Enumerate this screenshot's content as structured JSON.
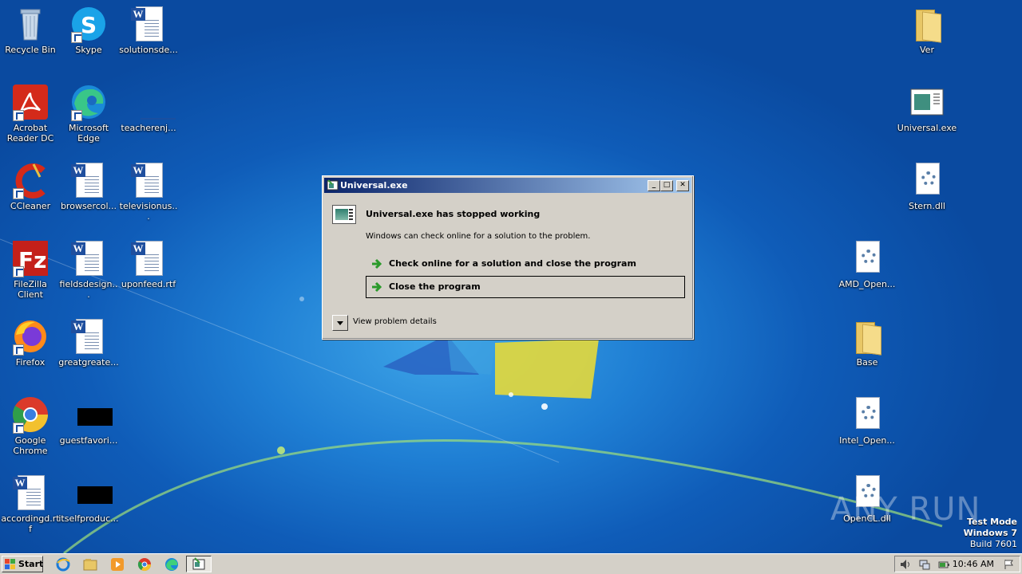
{
  "desktop": {
    "icons_left": [
      {
        "label": "Recycle Bin",
        "icon": "recycle-bin-icon"
      },
      {
        "label": "Skype",
        "icon": "skype-icon"
      },
      {
        "label": "solutionsde...",
        "icon": "word-document-icon"
      },
      {
        "label": "Acrobat Reader DC",
        "icon": "acrobat-icon"
      },
      {
        "label": "Microsoft Edge",
        "icon": "edge-icon"
      },
      {
        "label": "teacherenj...",
        "icon": "blank-file-icon"
      },
      {
        "label": "CCleaner",
        "icon": "ccleaner-icon"
      },
      {
        "label": "browsercol...",
        "icon": "word-document-icon"
      },
      {
        "label": "televisionus...",
        "icon": "word-document-icon"
      },
      {
        "label": "FileZilla Client",
        "icon": "filezilla-icon"
      },
      {
        "label": "fieldsdesign...",
        "icon": "word-document-icon"
      },
      {
        "label": "uponfeed.rtf",
        "icon": "word-document-icon"
      },
      {
        "label": "Firefox",
        "icon": "firefox-icon"
      },
      {
        "label": "greatgreate...",
        "icon": "word-document-icon"
      },
      {
        "label": "Google Chrome",
        "icon": "chrome-icon"
      },
      {
        "label": "guestfavori...",
        "icon": "black-file-icon"
      },
      {
        "label": "accordingd.rtf",
        "icon": "word-document-icon"
      },
      {
        "label": "itselfproduc...",
        "icon": "black-file-icon"
      }
    ],
    "icons_right": [
      {
        "label": "Ver",
        "icon": "folder-icon"
      },
      {
        "label": "Universal.exe",
        "icon": "app-window-icon"
      },
      {
        "label": "Stern.dll",
        "icon": "dll-gear-icon"
      },
      {
        "label": "AMD_Open...",
        "icon": "dll-gear-icon"
      },
      {
        "label": "Base",
        "icon": "folder-icon"
      },
      {
        "label": "Intel_Open...",
        "icon": "dll-gear-icon"
      },
      {
        "label": "OpenCL.dll",
        "icon": "dll-gear-icon"
      }
    ]
  },
  "dialog": {
    "title": "Universal.exe",
    "heading": "Universal.exe has stopped working",
    "message": "Windows can check online for a solution to the problem.",
    "option_check": "Check online for a solution and close the program",
    "option_close": "Close the program",
    "details_label": "View problem details",
    "btn_minimize": "_",
    "btn_maximize": "□",
    "btn_close": "✕"
  },
  "watermark": {
    "text": "ANY  RUN"
  },
  "testmode": {
    "line1": "Test Mode",
    "line2": "Windows 7",
    "line3": "Build 7601"
  },
  "taskbar": {
    "start_label": "Start",
    "clock": "10:46 AM"
  }
}
